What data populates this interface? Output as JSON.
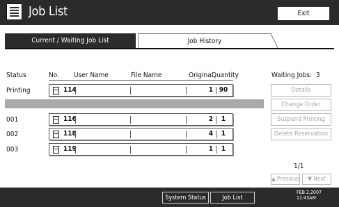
{
  "header": {
    "title": "Job List",
    "exit_label": "Exit"
  },
  "tabs": [
    {
      "label": "Current / Waiting Job List",
      "active": true
    },
    {
      "label": "Job History",
      "active": false
    }
  ],
  "columns": {
    "status": "Status",
    "no": "No.",
    "user_name": "User Name",
    "file_name": "File Name",
    "original": "Original",
    "quantity": "Quantity"
  },
  "jobs": [
    {
      "status": "Printing",
      "no": "114",
      "user_name": "",
      "file_name": "",
      "original": "1",
      "quantity": "90"
    },
    {
      "status": "001",
      "no": "116",
      "user_name": "",
      "file_name": "",
      "original": "2",
      "quantity": "1"
    },
    {
      "status": "002",
      "no": "118",
      "user_name": "",
      "file_name": "",
      "original": "4",
      "quantity": "1"
    },
    {
      "status": "003",
      "no": "119",
      "user_name": "",
      "file_name": "",
      "original": "1",
      "quantity": "1"
    }
  ],
  "side": {
    "waiting_label": "Waiting Jobs:",
    "waiting_count": "3",
    "buttons": [
      "Details",
      "Change Order",
      "Suspend Printing",
      "Delete Reservation"
    ],
    "page": "1/1",
    "previous_label": "Previous",
    "next_label": "Next"
  },
  "bottom": {
    "system_status": "System Status",
    "job_list": "Job List",
    "date": "FEB   2,2007",
    "time": "11:43AM"
  },
  "colors": {
    "bar": "#2b2b2b",
    "disabled_text": "#a6a6a6",
    "separator": "#a9a9a9"
  }
}
